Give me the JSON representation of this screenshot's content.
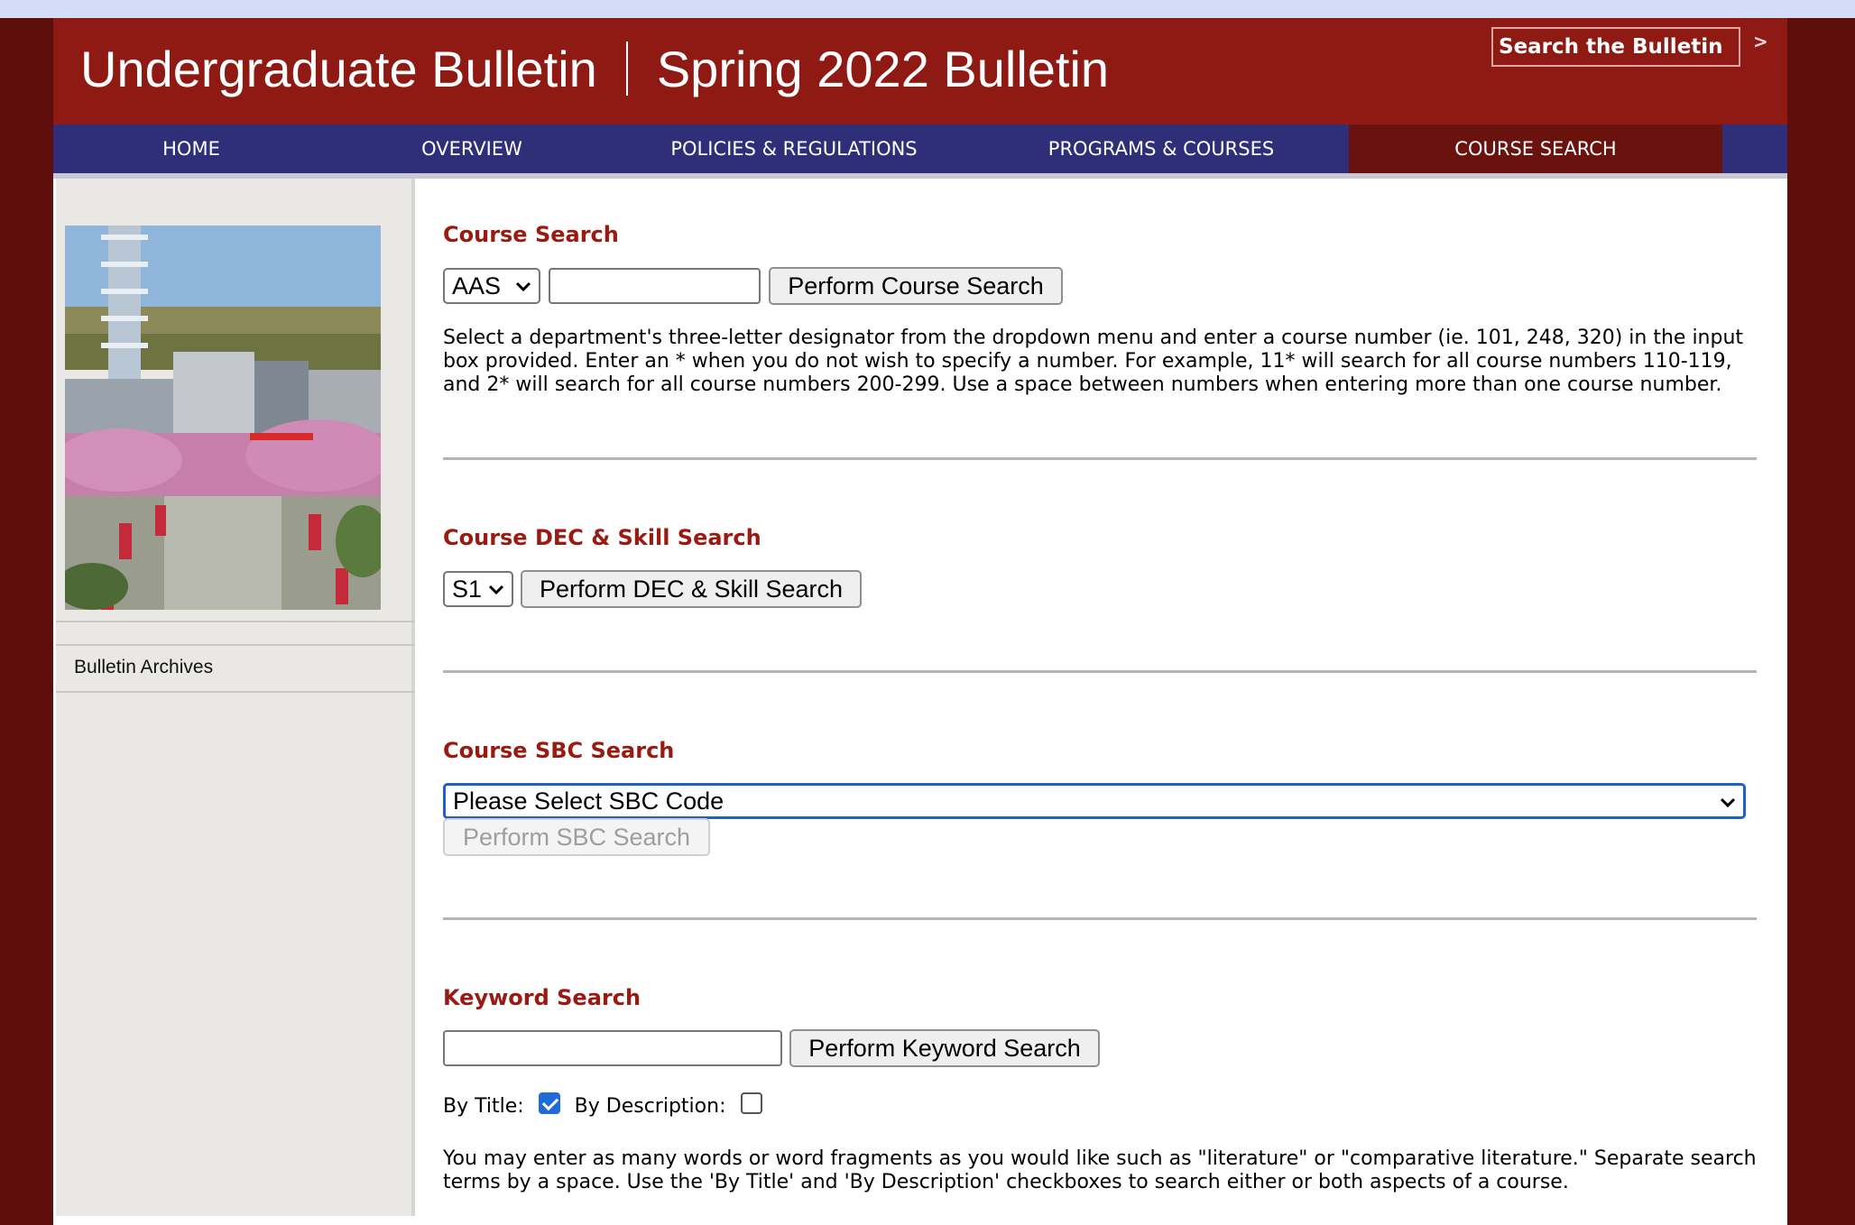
{
  "header": {
    "title_left": "Undergraduate Bulletin",
    "title_right": "Spring 2022 Bulletin",
    "search_label": "Search the Bulletin",
    "search_go": ">"
  },
  "nav": {
    "items": [
      {
        "label": "HOME"
      },
      {
        "label": "OVERVIEW"
      },
      {
        "label": "POLICIES & REGULATIONS"
      },
      {
        "label": "PROGRAMS & COURSES"
      },
      {
        "label": "COURSE SEARCH",
        "active": true
      }
    ]
  },
  "sidebar": {
    "archives_label": "Bulletin Archives"
  },
  "course_search": {
    "title": "Course Search",
    "department_selected": "AAS",
    "number_value": "",
    "button_label": "Perform Course Search",
    "description": "Select a department's three-letter designator from the dropdown menu and enter a course number (ie. 101, 248, 320) in the input box provided. Enter an * when you do not wish to specify a number. For example, 11* will search for all course numbers 110-119, and 2* will search for all course numbers 200-299. Use a space between numbers when entering more than one course number."
  },
  "dec_search": {
    "title": "Course DEC & Skill Search",
    "selected": "S1",
    "button_label": "Perform DEC & Skill Search"
  },
  "sbc_search": {
    "title": "Course SBC Search",
    "selected": "Please Select SBC Code",
    "button_label": "Perform SBC Search"
  },
  "keyword_search": {
    "title": "Keyword Search",
    "input_value": "",
    "button_label": "Perform Keyword Search",
    "by_title_label": "By Title:",
    "by_title_checked": true,
    "by_description_label": "By Description:",
    "by_description_checked": false,
    "description": "You may enter as many words or word fragments as you would like such as \"literature\" or \"comparative literature.\" Separate search terms by a space. Use the 'By Title' and 'By Description' checkboxes to search either or both aspects of a course."
  },
  "colors": {
    "brand_red": "#8e1a13",
    "nav_blue": "#2f2e78",
    "active_tab": "#6a120e",
    "section_title": "#9a1a12"
  }
}
